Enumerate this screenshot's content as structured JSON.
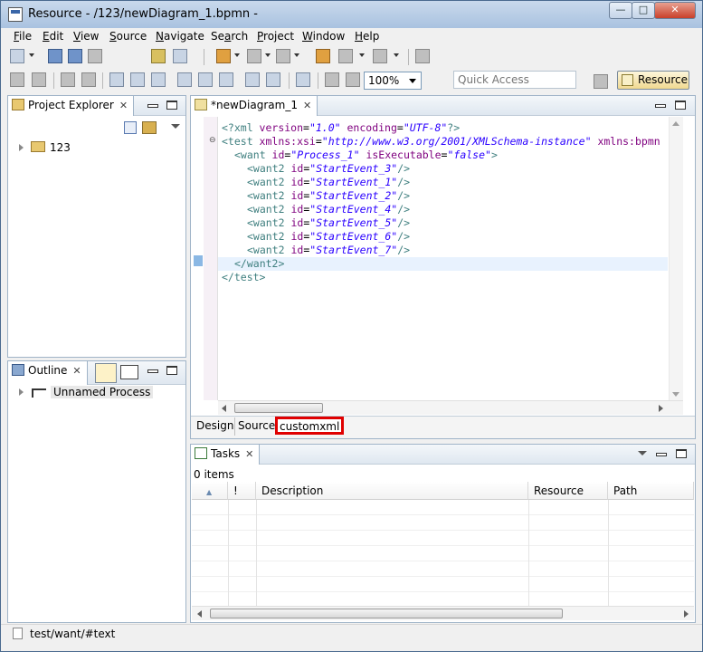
{
  "window": {
    "title": "Resource - /123/newDiagram_1.bpmn -",
    "controls": {
      "minimize": "—",
      "maximize": "□",
      "close": "✕"
    }
  },
  "menu": {
    "items": [
      {
        "label": "File",
        "mnemonic": "F",
        "rest": "ile"
      },
      {
        "label": "Edit",
        "mnemonic": "E",
        "rest": "dit"
      },
      {
        "label": "View",
        "mnemonic": "V",
        "rest": "iew"
      },
      {
        "label": "Source",
        "mnemonic": "S",
        "rest": "ource"
      },
      {
        "label": "Navigate",
        "mnemonic": "N",
        "rest": "avigate"
      },
      {
        "label": "Search",
        "mnemonic": "a",
        "pre": "Se",
        "rest": "rch"
      },
      {
        "label": "Project",
        "mnemonic": "P",
        "rest": "roject"
      },
      {
        "label": "Window",
        "mnemonic": "W",
        "rest": "indow"
      },
      {
        "label": "Help",
        "mnemonic": "H",
        "rest": "elp"
      }
    ]
  },
  "toolbar": {
    "zoom_value": "100%",
    "quick_access_placeholder": "Quick Access",
    "perspective_label": "Resource"
  },
  "project_explorer": {
    "tab_label": "Project Explorer",
    "tree": [
      {
        "label": "123",
        "icon": "project-folder-icon"
      }
    ]
  },
  "outline": {
    "tab_label": "Outline",
    "tree": [
      {
        "label": "Unnamed Process",
        "icon": "process-icon"
      }
    ]
  },
  "editor": {
    "tab_label": "*newDiagram_1",
    "lines": [
      {
        "indent": 0,
        "tokens": [
          {
            "t": "<?xml ",
            "c": "c-pi"
          },
          {
            "t": "version",
            "c": "c-attr"
          },
          {
            "t": "=",
            "c": ""
          },
          {
            "t": "\"1.0\"",
            "c": "c-val"
          },
          {
            "t": " encoding",
            "c": "c-attr"
          },
          {
            "t": "=",
            "c": ""
          },
          {
            "t": "\"UTF-8\"",
            "c": "c-val"
          },
          {
            "t": "?>",
            "c": "c-pi"
          }
        ]
      },
      {
        "indent": 0,
        "tokens": [
          {
            "t": "<test ",
            "c": "c-tag"
          },
          {
            "t": "xmlns:xsi",
            "c": "c-attr"
          },
          {
            "t": "=",
            "c": ""
          },
          {
            "t": "\"http://www.w3.org/2001/XMLSchema-instance\"",
            "c": "c-val"
          },
          {
            "t": " xmlns:bpmn",
            "c": "c-attr"
          }
        ]
      },
      {
        "indent": 1,
        "tokens": [
          {
            "t": "<want ",
            "c": "c-tag"
          },
          {
            "t": "id",
            "c": "c-attr"
          },
          {
            "t": "=",
            "c": ""
          },
          {
            "t": "\"Process_1\"",
            "c": "c-val"
          },
          {
            "t": " isExecutable",
            "c": "c-attr"
          },
          {
            "t": "=",
            "c": ""
          },
          {
            "t": "\"false\"",
            "c": "c-val"
          },
          {
            "t": ">",
            "c": "c-tag"
          }
        ]
      },
      {
        "indent": 2,
        "tokens": [
          {
            "t": "<want2 ",
            "c": "c-tag"
          },
          {
            "t": "id",
            "c": "c-attr"
          },
          {
            "t": "=",
            "c": ""
          },
          {
            "t": "\"StartEvent_3\"",
            "c": "c-val"
          },
          {
            "t": "/>",
            "c": "c-tag"
          }
        ]
      },
      {
        "indent": 2,
        "tokens": [
          {
            "t": "<want2 ",
            "c": "c-tag"
          },
          {
            "t": "id",
            "c": "c-attr"
          },
          {
            "t": "=",
            "c": ""
          },
          {
            "t": "\"StartEvent_1\"",
            "c": "c-val"
          },
          {
            "t": "/>",
            "c": "c-tag"
          }
        ]
      },
      {
        "indent": 2,
        "tokens": [
          {
            "t": "<want2 ",
            "c": "c-tag"
          },
          {
            "t": "id",
            "c": "c-attr"
          },
          {
            "t": "=",
            "c": ""
          },
          {
            "t": "\"StartEvent_2\"",
            "c": "c-val"
          },
          {
            "t": "/>",
            "c": "c-tag"
          }
        ]
      },
      {
        "indent": 2,
        "tokens": [
          {
            "t": "<want2 ",
            "c": "c-tag"
          },
          {
            "t": "id",
            "c": "c-attr"
          },
          {
            "t": "=",
            "c": ""
          },
          {
            "t": "\"StartEvent_4\"",
            "c": "c-val"
          },
          {
            "t": "/>",
            "c": "c-tag"
          }
        ]
      },
      {
        "indent": 2,
        "tokens": [
          {
            "t": "<want2 ",
            "c": "c-tag"
          },
          {
            "t": "id",
            "c": "c-attr"
          },
          {
            "t": "=",
            "c": ""
          },
          {
            "t": "\"StartEvent_5\"",
            "c": "c-val"
          },
          {
            "t": "/>",
            "c": "c-tag"
          }
        ]
      },
      {
        "indent": 2,
        "tokens": [
          {
            "t": "<want2 ",
            "c": "c-tag"
          },
          {
            "t": "id",
            "c": "c-attr"
          },
          {
            "t": "=",
            "c": ""
          },
          {
            "t": "\"StartEvent_6\"",
            "c": "c-val"
          },
          {
            "t": "/>",
            "c": "c-tag"
          }
        ]
      },
      {
        "indent": 2,
        "tokens": [
          {
            "t": "<want2 ",
            "c": "c-tag"
          },
          {
            "t": "id",
            "c": "c-attr"
          },
          {
            "t": "=",
            "c": ""
          },
          {
            "t": "\"StartEvent_7\"",
            "c": "c-val"
          },
          {
            "t": "/>",
            "c": "c-tag"
          }
        ]
      },
      {
        "indent": 1,
        "tokens": [
          {
            "t": "</want2>",
            "c": "c-tag"
          }
        ],
        "current": true
      },
      {
        "indent": 0,
        "tokens": [
          {
            "t": "</test>",
            "c": "c-tag"
          }
        ]
      }
    ],
    "page_tabs": [
      "Design",
      "Source",
      "customxml"
    ]
  },
  "tasks": {
    "tab_label": "Tasks",
    "count_label": "0 items",
    "columns": [
      "!",
      "Description",
      "Resource",
      "Path"
    ]
  },
  "status": {
    "path": "test/want/#text"
  },
  "colors": {
    "highlight_box": "#e00000",
    "xml_tag": "#3f7f7f",
    "xml_attr": "#7f007f",
    "xml_value": "#2a00ff"
  }
}
